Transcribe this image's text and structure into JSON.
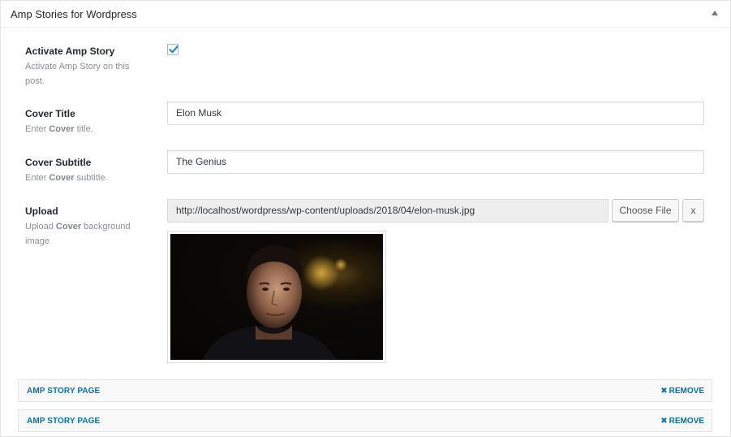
{
  "metabox": {
    "title": "Amp Stories for Wordpress",
    "toggle_icon": "arrow-up-icon"
  },
  "fields": {
    "activate": {
      "label": "Activate Amp Story",
      "desc": "Activate Amp Story on this post.",
      "checked": true
    },
    "cover_title": {
      "label": "Cover Title",
      "desc_pre": "Enter ",
      "desc_bold": "Cover",
      "desc_post": " title.",
      "value": "Elon Musk"
    },
    "cover_subtitle": {
      "label": "Cover Subtitle",
      "desc_pre": "Enter ",
      "desc_bold": "Cover",
      "desc_post": " subtitle.",
      "value": "The Genius"
    },
    "upload": {
      "label": "Upload",
      "desc_pre": "Upload ",
      "desc_bold": "Cover",
      "desc_post": " background image",
      "value": "http://localhost/wordpress/wp-content/uploads/2018/04/elon-musk.jpg",
      "choose_label": "Choose File",
      "clear_label": "x"
    }
  },
  "story_pages": [
    {
      "title": "AMP STORY PAGE",
      "remove_label": "REMOVE"
    },
    {
      "title": "AMP STORY PAGE",
      "remove_label": "REMOVE"
    }
  ],
  "colors": {
    "link": "#0073aa",
    "label": "#23282d",
    "muted": "#8c8f94",
    "checkmark": "#1e8cbe"
  }
}
